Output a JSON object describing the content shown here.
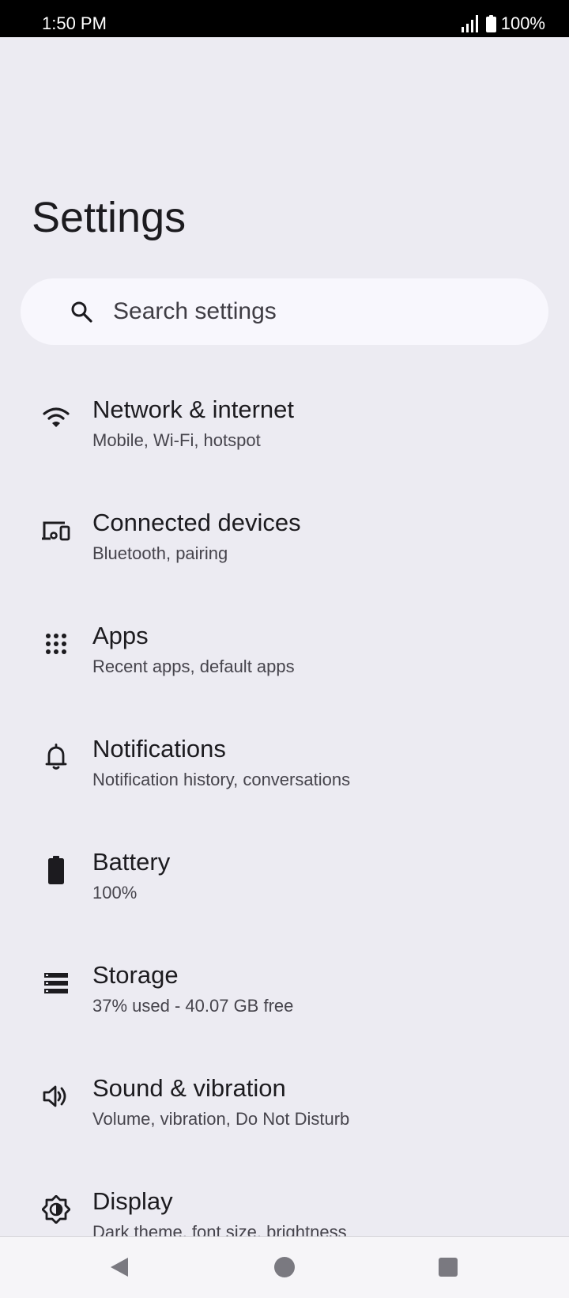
{
  "status_bar": {
    "time": "1:50 PM",
    "battery_percent": "100%",
    "icons": [
      "signal-icon",
      "battery-icon"
    ]
  },
  "page": {
    "title": "Settings"
  },
  "search": {
    "placeholder": "Search settings",
    "icon": "search-icon"
  },
  "settings": [
    {
      "title": "Network & internet",
      "subtitle": "Mobile, Wi-Fi, hotspot",
      "icon": "wifi-icon"
    },
    {
      "title": "Connected devices",
      "subtitle": "Bluetooth, pairing",
      "icon": "devices-icon"
    },
    {
      "title": "Apps",
      "subtitle": "Recent apps, default apps",
      "icon": "apps-grid-icon"
    },
    {
      "title": "Notifications",
      "subtitle": "Notification history, conversations",
      "icon": "bell-icon"
    },
    {
      "title": "Battery",
      "subtitle": "100%",
      "icon": "battery-icon"
    },
    {
      "title": "Storage",
      "subtitle": "37% used - 40.07 GB free",
      "icon": "storage-icon"
    },
    {
      "title": "Sound & vibration",
      "subtitle": "Volume, vibration, Do Not Disturb",
      "icon": "volume-icon"
    },
    {
      "title": "Display",
      "subtitle": "Dark theme, font size, brightness",
      "icon": "display-brightness-icon"
    }
  ],
  "nav_bar": {
    "buttons": [
      "back-icon",
      "home-icon",
      "recents-icon"
    ]
  },
  "colors": {
    "background": "#ECEBF2",
    "search_background": "#F8F7FD",
    "text_primary": "#1C1B1F",
    "text_secondary": "#46444C",
    "status_bar": "#000000"
  }
}
